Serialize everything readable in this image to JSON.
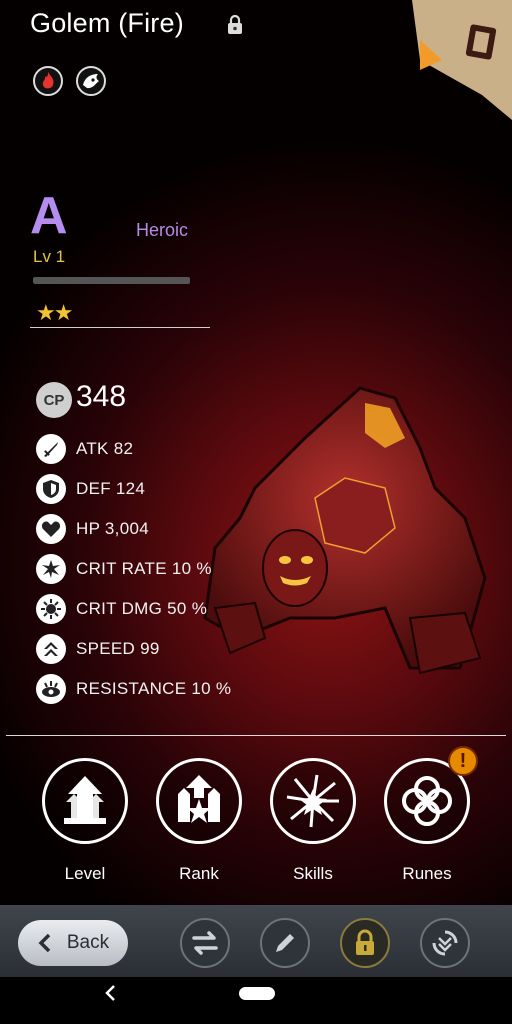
{
  "header": {
    "title": "Golem (Fire)",
    "icons": [
      "fire-element-icon",
      "monster-type-icon"
    ],
    "corner_icon": "codex-book-icon"
  },
  "profile": {
    "grade": "A",
    "rarity": "Heroic",
    "level_label": "Lv 1",
    "xp_progress": 0,
    "stars": "★★",
    "star_count": 2
  },
  "stats": {
    "cp_label": "CP",
    "cp_value": "348",
    "rows": [
      {
        "label": "ATK 82",
        "icon": "sword-icon"
      },
      {
        "label": "DEF 124",
        "icon": "shield-icon"
      },
      {
        "label": "HP 3,004",
        "icon": "heart-icon"
      },
      {
        "label": "CRIT RATE 10 %",
        "icon": "crit-rate-icon"
      },
      {
        "label": "CRIT DMG 50 %",
        "icon": "crit-dmg-icon"
      },
      {
        "label": "SPEED 99",
        "icon": "speed-icon"
      },
      {
        "label": "RESISTANCE 10 %",
        "icon": "resistance-icon"
      }
    ]
  },
  "actions": [
    {
      "label": "Level",
      "icon": "level-up-icon"
    },
    {
      "label": "Rank",
      "icon": "rank-up-icon"
    },
    {
      "label": "Skills",
      "icon": "skills-icon"
    },
    {
      "label": "Runes",
      "icon": "runes-icon"
    }
  ],
  "alert": "!",
  "bottom_bar": {
    "back_label": "Back",
    "buttons": [
      "swap-icon",
      "edit-icon",
      "lock-icon",
      "evolve-icon"
    ]
  },
  "colors": {
    "grade": "#b58cf0",
    "level": "#e6c24d",
    "stars": "#f1c232",
    "alert": "#e68a00"
  }
}
